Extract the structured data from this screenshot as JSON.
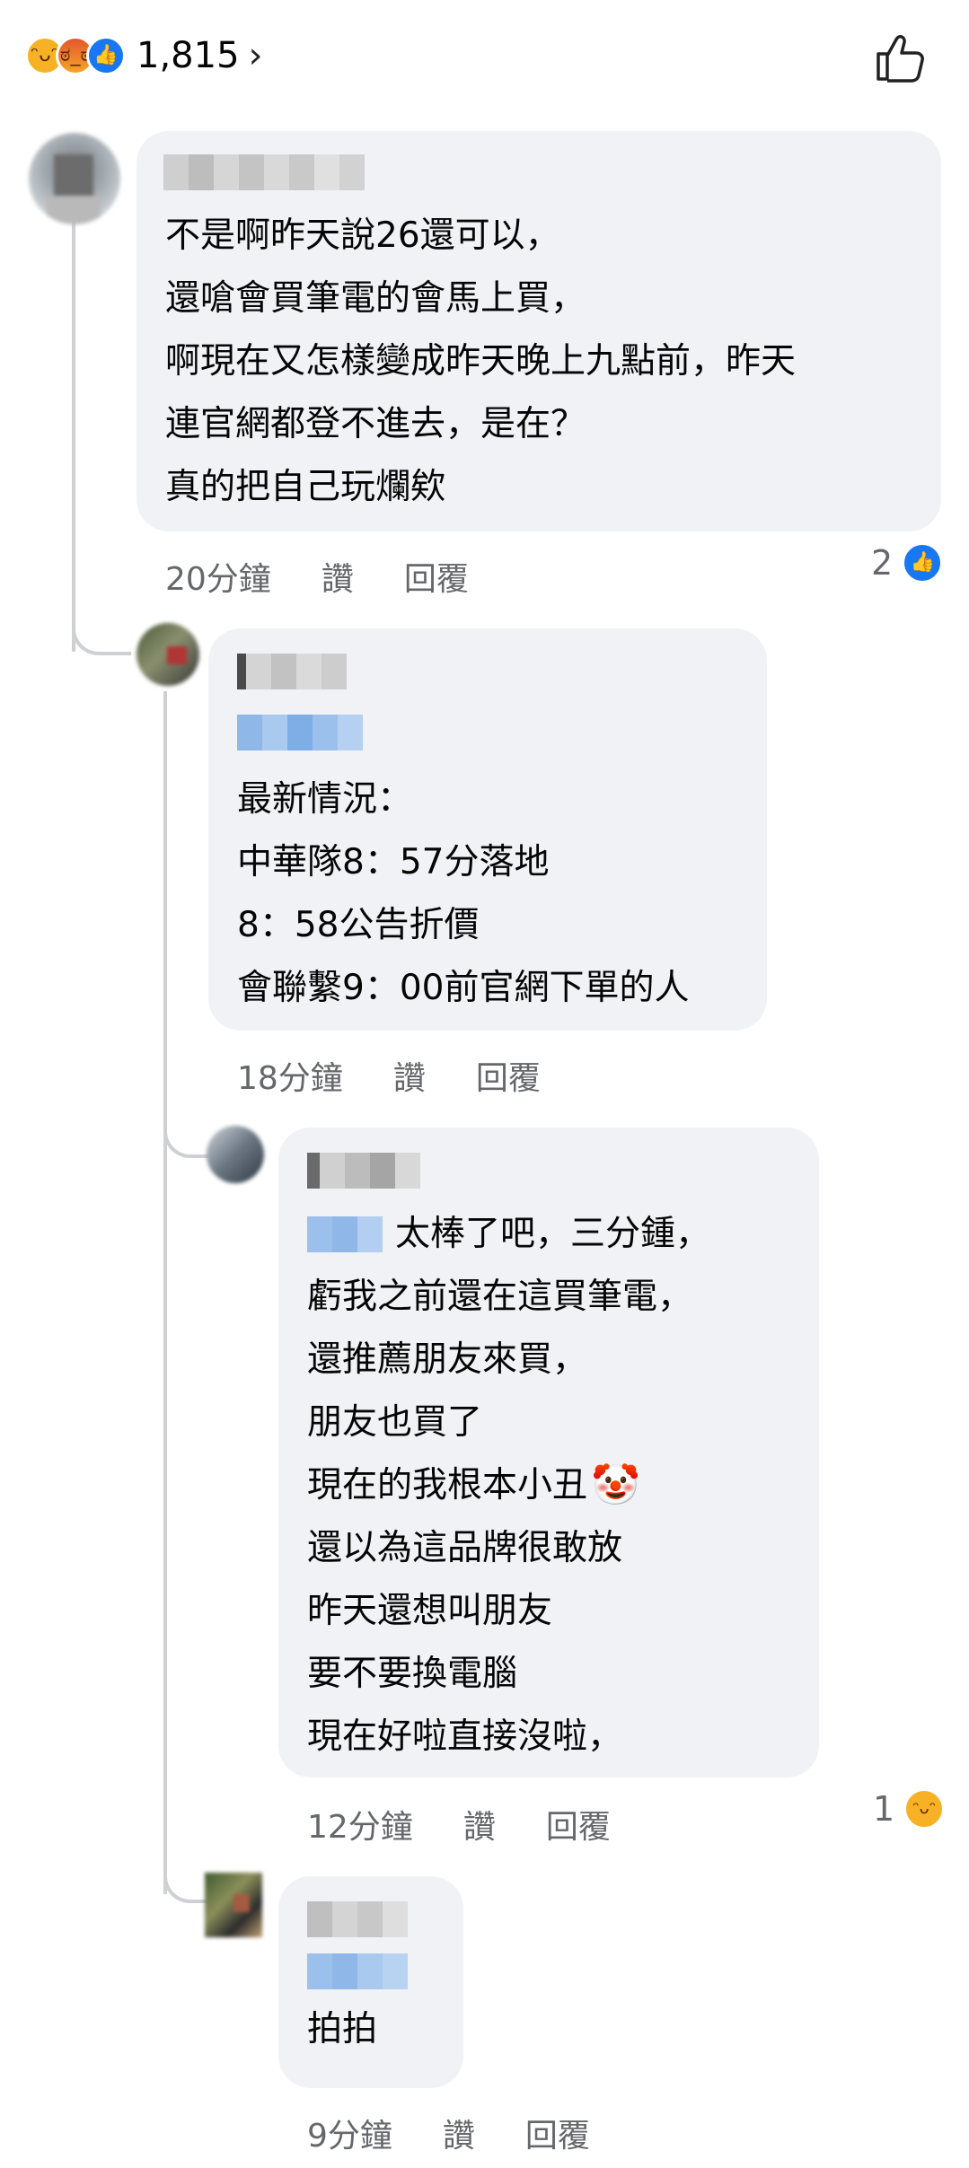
{
  "header": {
    "reaction_count": "1,815",
    "chevron": "›",
    "reaction_icons": [
      "haha-icon",
      "angry-icon",
      "like-icon"
    ]
  },
  "comments": [
    {
      "author_blurred": true,
      "lines": [
        "不是啊昨天說26還可以，",
        "還嗆會買筆電的會馬上買，",
        "啊現在又怎樣變成昨天晚上九點前，昨天",
        "連官網都登不進去，是在？",
        "真的把自己玩爛欸"
      ],
      "time": "20分鐘",
      "like": "讚",
      "reply": "回覆",
      "reaction_count": "2",
      "reaction_icon": "like-icon"
    },
    {
      "author_blurred": true,
      "lines": [
        "最新情況：",
        "中華隊8：57分落地",
        "8：58公告折價",
        "會聯繫9：00前官網下單的人"
      ],
      "time": "18分鐘",
      "like": "讚",
      "reply": "回覆"
    },
    {
      "author_blurred": true,
      "first_line_suffix": "太棒了吧，三分鍾，",
      "lines": [
        "虧我之前還在這買筆電，",
        "還推薦朋友來買，",
        "朋友也買了",
        "現在的我根本小丑",
        "還以為這品牌很敢放",
        "昨天還想叫朋友",
        "要不要換電腦",
        "現在好啦直接沒啦，"
      ],
      "emoji": "🤡",
      "time": "12分鐘",
      "like": "讚",
      "reply": "回覆",
      "reaction_count": "1",
      "reaction_icon": "haha-icon"
    },
    {
      "author_blurred": true,
      "lines": [
        "拍拍"
      ],
      "time": "9分鐘",
      "like": "讚",
      "reply": "回覆"
    }
  ],
  "colors": {
    "bubble": "#f0f2f5",
    "meta": "#65676b",
    "like_blue": "#1877f2",
    "haha_yellow": "#f7b125"
  }
}
